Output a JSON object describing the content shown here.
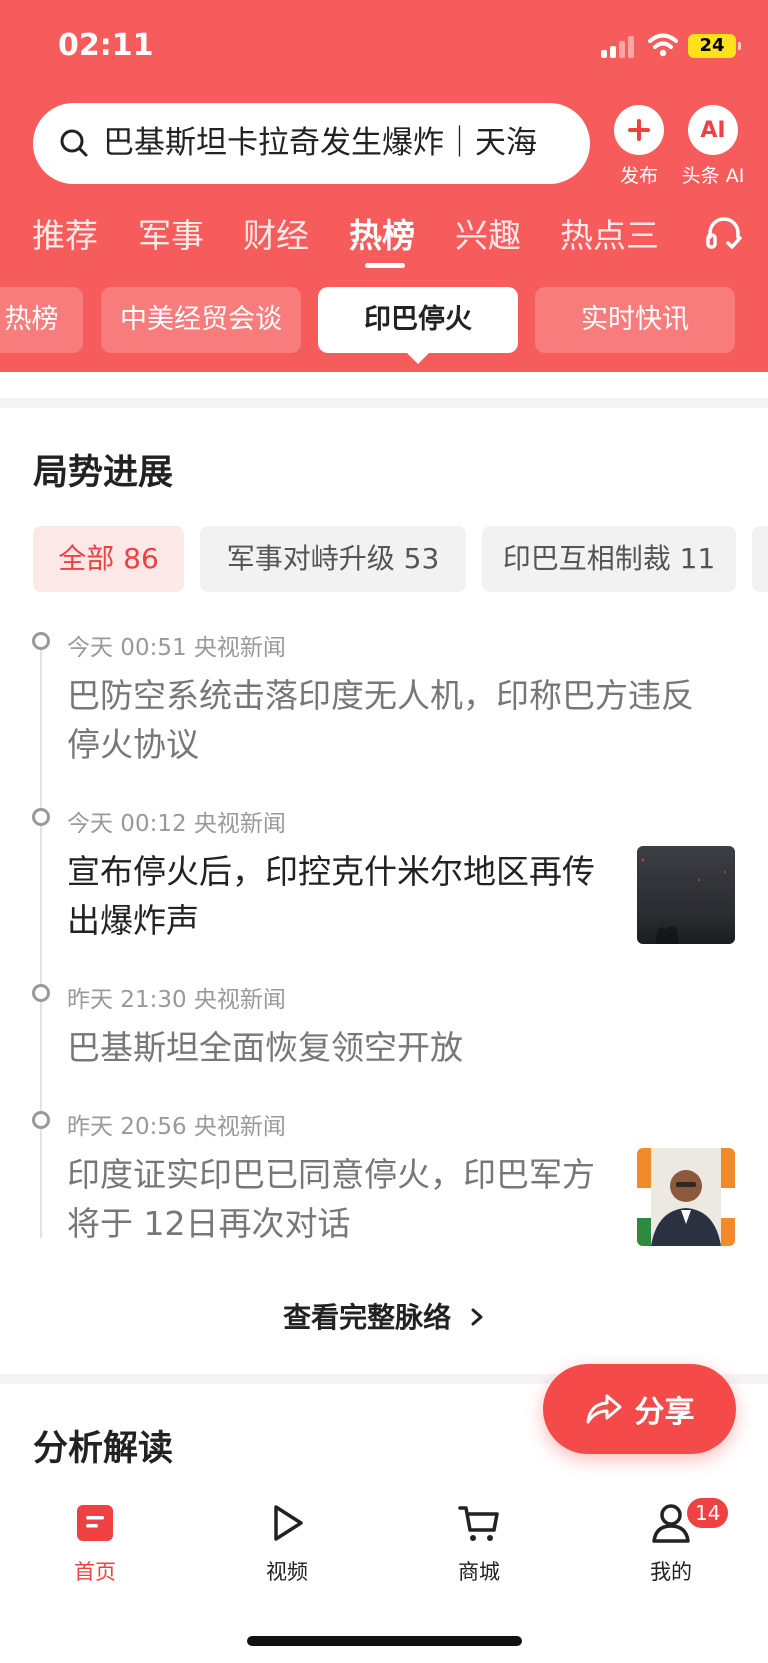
{
  "status_bar": {
    "time": "02:11",
    "battery": "24"
  },
  "search": {
    "query": "巴基斯坦卡拉奇发生爆炸｜天海"
  },
  "top_actions": [
    {
      "icon": "plus-icon",
      "label": "发布"
    },
    {
      "icon": "ai-icon",
      "glyph": "AI",
      "label": "头条 AI"
    }
  ],
  "channel_tabs": [
    "推荐",
    "军事",
    "财经",
    "热榜",
    "兴趣",
    "热点三"
  ],
  "active_channel": "热榜",
  "topic_chips": [
    "热榜",
    "中美经贸会谈",
    "印巴停火",
    "实时快讯"
  ],
  "active_topic": "印巴停火",
  "situation": {
    "title": "局势进展",
    "filters": [
      {
        "label": "全部 86",
        "active": true
      },
      {
        "label": "军事对峙升级 53",
        "active": false
      },
      {
        "label": "印巴互相制裁 11",
        "active": false
      }
    ],
    "items": [
      {
        "meta": "今天 00:51 央视新闻",
        "title_line1": "巴防空系统击落印度无人机，印称巴方违反",
        "title_line2": "停火协议",
        "read": true,
        "thumb": null
      },
      {
        "meta": "今天 00:12 央视新闻",
        "title_line1": "宣布停火后，印控克什米尔地区再传",
        "title_line2": "出爆炸声",
        "read": false,
        "thumb": "night-sky-photo"
      },
      {
        "meta": "昨天 21:30 央视新闻",
        "title_line1": "巴基斯坦全面恢复领空开放",
        "title_line2": "",
        "read": true,
        "thumb": null
      },
      {
        "meta": "昨天 20:56 央视新闻",
        "title_line1": "印度证实印巴已同意停火，印巴军方",
        "title_line2": "将于 12日再次对话",
        "read": true,
        "thumb": "official-portrait-photo"
      }
    ],
    "full_link": "查看完整脉络"
  },
  "analysis": {
    "title": "分析解读"
  },
  "share": {
    "label": "分享"
  },
  "bottom_nav": [
    {
      "label": "首页",
      "icon": "home-icon",
      "active": true
    },
    {
      "label": "视频",
      "icon": "play-icon",
      "active": false
    },
    {
      "label": "商城",
      "icon": "cart-icon",
      "active": false
    },
    {
      "label": "我的",
      "icon": "profile-icon",
      "active": false
    }
  ],
  "nav_badge": "14",
  "colors": {
    "brand_red": "#f75c5c",
    "accent": "#f04142"
  }
}
